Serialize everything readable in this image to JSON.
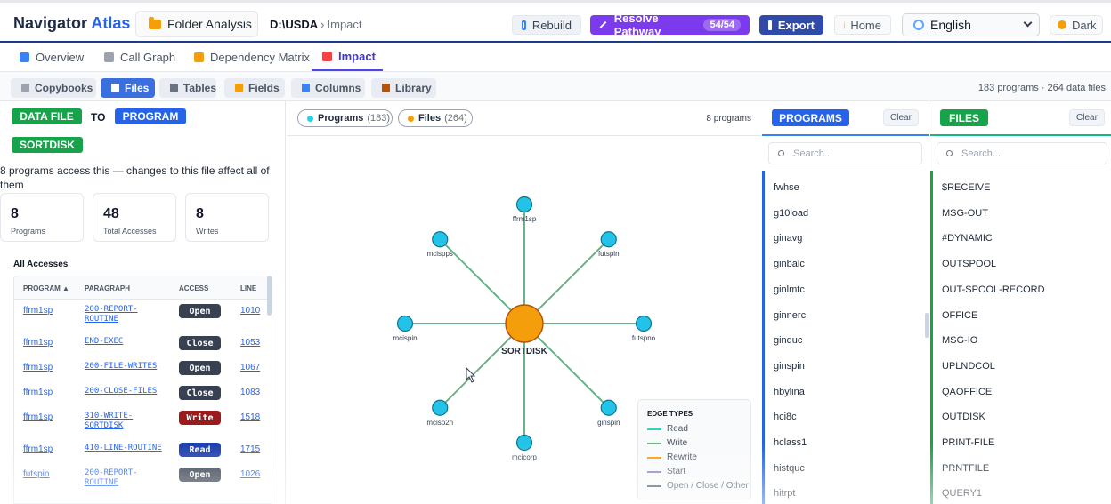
{
  "header": {
    "brand_main": "Navigator",
    "brand_accent": "Atlas",
    "folder_button": "Folder Analysis",
    "path_root": "D:\\USDA",
    "path_sep": "›",
    "path_current": "Impact",
    "rebuild": "Rebuild",
    "resolve": "Resolve Pathway",
    "resolve_badge": "54/54",
    "export": "Export",
    "home": "Home",
    "language": "English",
    "theme": "Dark"
  },
  "tabs": [
    {
      "label": "Overview",
      "color": "#3b82f6"
    },
    {
      "label": "Call Graph",
      "color": "#9ca3af"
    },
    {
      "label": "Dependency Matrix",
      "color": "#f59e0b"
    },
    {
      "label": "Impact",
      "color": "#ef4444"
    }
  ],
  "subtabs": [
    {
      "label": "Copybooks",
      "color": "#9ca3af"
    },
    {
      "label": "Files",
      "color": "#ffffff"
    },
    {
      "label": "Tables",
      "color": "#6b7280"
    },
    {
      "label": "Fields",
      "color": "#f59e0b"
    },
    {
      "label": "Columns",
      "color": "#3b82f6"
    },
    {
      "label": "Library",
      "color": "#b45309"
    }
  ],
  "summary": "183 programs · 264 data files",
  "left": {
    "from_label": "DATA FILE",
    "to_label": "TO",
    "target_label": "PROGRAM",
    "selected": "SORTDISK",
    "description": "8 programs access this — changes to this file affect all of them",
    "stats": [
      {
        "value": "8",
        "label": "Programs"
      },
      {
        "value": "48",
        "label": "Total Accesses"
      },
      {
        "value": "8",
        "label": "Writes"
      }
    ],
    "all_accesses": "All Accesses",
    "columns": [
      "PROGRAM ▲",
      "PARAGRAPH",
      "ACCESS",
      "LINE"
    ],
    "rows": [
      {
        "program": "ffrm1sp",
        "paragraph": "200-REPORT-ROUTINE",
        "access": "Open",
        "line": "1010"
      },
      {
        "program": "ffrm1sp",
        "paragraph": "END-EXEC",
        "access": "Close",
        "line": "1053"
      },
      {
        "program": "ffrm1sp",
        "paragraph": "200-FILE-WRITES",
        "access": "Open",
        "line": "1067"
      },
      {
        "program": "ffrm1sp",
        "paragraph": "200-CLOSE-FILES",
        "access": "Close",
        "line": "1083"
      },
      {
        "program": "ffrm1sp",
        "paragraph": "310-WRITE-SORTDISK",
        "access": "Write",
        "line": "1518"
      },
      {
        "program": "ffrm1sp",
        "paragraph": "410-LINE-ROUTINE",
        "access": "Read",
        "line": "1715"
      },
      {
        "program": "futspin",
        "paragraph": "200-REPORT-ROUTINE",
        "access": "Open",
        "line": "1026"
      }
    ],
    "access_colors": {
      "Open": "#374151",
      "Close": "#374151",
      "Write": "#991b1b",
      "Read": "#1e40af"
    }
  },
  "graph": {
    "filter_programs": "Programs",
    "filter_programs_count": "(183)",
    "filter_files": "Files",
    "filter_files_count": "(264)",
    "count_label": "8 programs",
    "center": "SORTDISK",
    "nodes": [
      "ffrm1sp",
      "futspin",
      "futspno",
      "ginspin",
      "mcicorp",
      "mcisp2n",
      "mcispin",
      "mcispps"
    ],
    "legend_title": "EDGE TYPES",
    "legend": [
      {
        "label": "Read",
        "color": "#2dd4bf"
      },
      {
        "label": "Write",
        "color": "#6ab187"
      },
      {
        "label": "Rewrite",
        "color": "#f59e0b"
      },
      {
        "label": "Start",
        "color": "#8b7fd6"
      },
      {
        "label": "Open / Close / Other",
        "color": "#4b5563"
      }
    ]
  },
  "programs_list": {
    "title": "PROGRAMS",
    "clear": "Clear",
    "placeholder": "Search...",
    "items": [
      "fwhse",
      "g10load",
      "ginavg",
      "ginbalc",
      "ginlmtc",
      "ginnerc",
      "ginquc",
      "ginspin",
      "hbylina",
      "hci8c",
      "hclass1",
      "histquc",
      "hitrpt"
    ]
  },
  "files_list": {
    "title": "FILES",
    "clear": "Clear",
    "placeholder": "Search...",
    "items": [
      "$RECEIVE",
      "MSG-OUT",
      "#DYNAMIC",
      "OUTSPOOL",
      "OUT-SPOOL-RECORD",
      "OFFICE",
      "MSG-IO",
      "UPLNDCOL",
      "QAOFFICE",
      "OUTDISK",
      "PRINT-FILE",
      "PRNTFILE",
      "QUERY1"
    ]
  }
}
